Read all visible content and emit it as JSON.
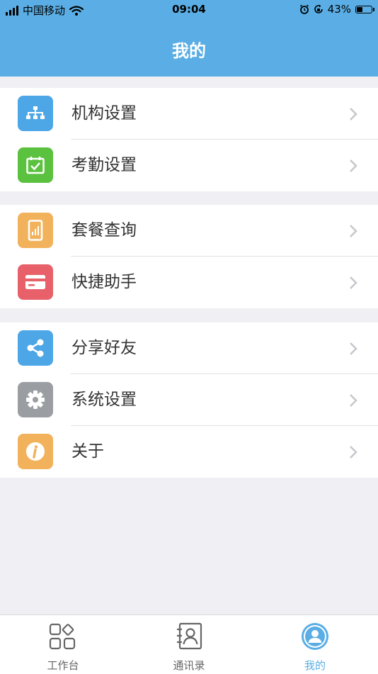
{
  "status_bar": {
    "carrier": "中国移动",
    "time": "09:04",
    "battery": "43%",
    "battery_level": 0.43
  },
  "header": {
    "title": "我的"
  },
  "groups": [
    {
      "items": [
        {
          "label": "机构设置",
          "icon": "org-chart-icon",
          "color": "#4da6e6"
        },
        {
          "label": "考勤设置",
          "icon": "calendar-check-icon",
          "color": "#5ac23e"
        }
      ]
    },
    {
      "items": [
        {
          "label": "套餐查询",
          "icon": "phone-plan-icon",
          "color": "#f2b25c"
        },
        {
          "label": "快捷助手",
          "icon": "card-icon",
          "color": "#e8606a"
        }
      ]
    },
    {
      "items": [
        {
          "label": "分享好友",
          "icon": "share-icon",
          "color": "#4da6e6"
        },
        {
          "label": "系统设置",
          "icon": "gear-icon",
          "color": "#9a9ea3"
        },
        {
          "label": "关于",
          "icon": "info-icon",
          "color": "#f2b25c"
        }
      ]
    }
  ],
  "tabbar": {
    "active_color": "#5aaee5",
    "tabs": [
      {
        "label": "工作台",
        "icon": "grid-icon",
        "active": false
      },
      {
        "label": "通讯录",
        "icon": "contacts-icon",
        "active": false
      },
      {
        "label": "我的",
        "icon": "profile-icon",
        "active": true
      }
    ]
  }
}
